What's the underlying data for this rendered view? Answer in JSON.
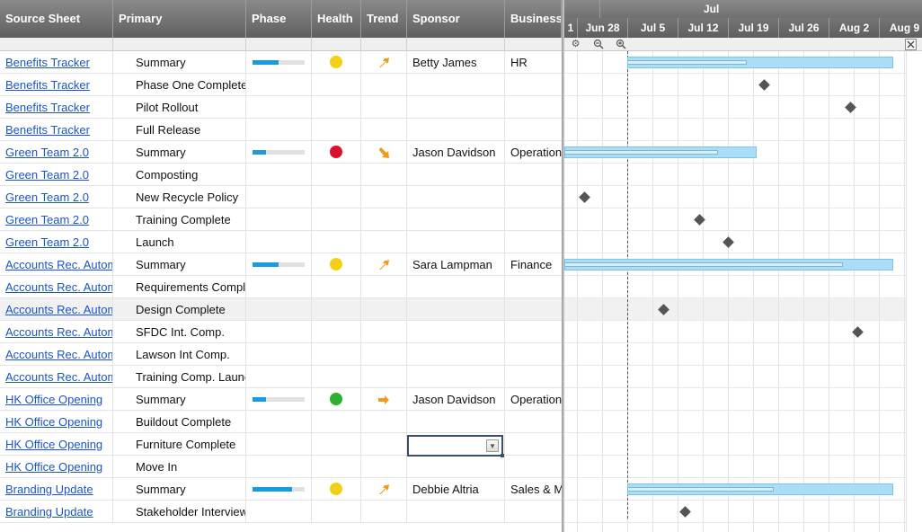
{
  "columns": [
    {
      "key": "source",
      "label": "Source Sheet"
    },
    {
      "key": "primary",
      "label": "Primary"
    },
    {
      "key": "phase",
      "label": "Phase"
    },
    {
      "key": "health",
      "label": "Health"
    },
    {
      "key": "trend",
      "label": "Trend"
    },
    {
      "key": "sponsor",
      "label": "Sponsor"
    },
    {
      "key": "business",
      "label": "Business"
    }
  ],
  "colors": {
    "link": "#1a55c9",
    "health_yellow": "#f2d115",
    "health_red": "#d9112c",
    "health_green": "#2cb22c",
    "trend_orange": "#f29a1a",
    "phase_fill": "#1a9be0",
    "gantt_bar": "#a9def6"
  },
  "rows": [
    {
      "source": "Benefits Tracker",
      "primary": "Summary",
      "phase": 0.5,
      "health": "yellow",
      "trend": "up-right-arrow-icon",
      "sponsor": "Betty James",
      "business": "HR"
    },
    {
      "source": "Benefits Tracker",
      "primary": "Phase One Complete",
      "sponsor": "",
      "business": ""
    },
    {
      "source": "Benefits Tracker",
      "primary": "Pilot Rollout",
      "sponsor": "",
      "business": ""
    },
    {
      "source": "Benefits Tracker",
      "primary": "Full Release",
      "sponsor": "",
      "business": ""
    },
    {
      "source": "Green Team 2.0",
      "primary": "Summary",
      "phase": 0.25,
      "health": "red",
      "trend": "down-right-arrow-icon",
      "sponsor": "Jason Davidson",
      "business": "Operations"
    },
    {
      "source": "Green Team 2.0",
      "primary": "Composting",
      "sponsor": "",
      "business": ""
    },
    {
      "source": "Green Team 2.0",
      "primary": "New Recycle Policy",
      "sponsor": "",
      "business": ""
    },
    {
      "source": "Green Team 2.0",
      "primary": "Training Complete",
      "sponsor": "",
      "business": ""
    },
    {
      "source": "Green Team 2.0",
      "primary": "Launch",
      "sponsor": "",
      "business": ""
    },
    {
      "source": "Accounts Rec. Automation",
      "primary": "Summary",
      "phase": 0.5,
      "health": "yellow",
      "trend": "up-right-arrow-icon",
      "sponsor": "Sara Lampman",
      "business": "Finance"
    },
    {
      "source": "Accounts Rec. Automation",
      "primary": "Requirements Complete",
      "sponsor": "",
      "business": ""
    },
    {
      "source": "Accounts Rec. Automation",
      "primary": "Design Complete",
      "sponsor": "",
      "business": "",
      "highlight": true
    },
    {
      "source": "Accounts Rec. Automation",
      "primary": "SFDC Int. Comp.",
      "sponsor": "",
      "business": ""
    },
    {
      "source": "Accounts Rec. Automation",
      "primary": "Lawson Int Comp.",
      "sponsor": "",
      "business": ""
    },
    {
      "source": "Accounts Rec. Automation",
      "primary": "Training Comp. Launch",
      "sponsor": "",
      "business": ""
    },
    {
      "source": "HK Office Opening",
      "primary": "Summary",
      "phase": 0.25,
      "health": "green",
      "trend": "right-arrow-icon",
      "sponsor": "Jason Davidson",
      "business": "Operations"
    },
    {
      "source": "HK Office Opening",
      "primary": "Buildout Complete",
      "sponsor": "",
      "business": ""
    },
    {
      "source": "HK Office Opening",
      "primary": "Furniture Complete",
      "sponsor": "",
      "business": "",
      "editing": true
    },
    {
      "source": "HK Office Opening",
      "primary": "Move In",
      "sponsor": "",
      "business": ""
    },
    {
      "source": "Branding Update",
      "primary": "Summary",
      "phase": 0.75,
      "health": "yellow",
      "trend": "up-right-arrow-icon",
      "sponsor": "Debbie Altria",
      "business": "Sales & Marketing"
    },
    {
      "source": "Branding Update",
      "primary": "Stakeholder Interviews",
      "sponsor": "",
      "business": ""
    }
  ],
  "gantt": {
    "month_label": "Jul",
    "left_cut_label": "1",
    "weeks": [
      "Jun 28",
      "Jul 5",
      "Jul 12",
      "Jul 19",
      "Jul 26",
      "Aug 2",
      "Aug 9"
    ],
    "tools": [
      "gear-icon",
      "zoom-out-icon",
      "zoom-in-icon"
    ],
    "close_icon": "close-icon",
    "today_label": "Jul 5",
    "bars": [
      {
        "row": 0,
        "start": "Jul 5",
        "end": "Aug 11",
        "progress": 0.45
      },
      {
        "row": 4,
        "start": "Jun 21",
        "end": "Jul 23",
        "progress": 0.8
      },
      {
        "row": 9,
        "start": "Jun 21",
        "end": "Aug 11",
        "progress": 0.85
      },
      {
        "row": 19,
        "start": "Jul 5",
        "end": "Aug 11",
        "progress": 0.55
      }
    ],
    "milestones": [
      {
        "row": 1,
        "date": "Jul 24"
      },
      {
        "row": 2,
        "date": "Aug 5"
      },
      {
        "row": 5,
        "date": "Jun 24"
      },
      {
        "row": 6,
        "date": "Jun 29"
      },
      {
        "row": 7,
        "date": "Jul 15"
      },
      {
        "row": 8,
        "date": "Jul 19"
      },
      {
        "row": 10,
        "date": "Jun 25"
      },
      {
        "row": 11,
        "date": "Jul 10"
      },
      {
        "row": 12,
        "date": "Aug 6"
      },
      {
        "row": 20,
        "date": "Jul 13"
      }
    ]
  }
}
